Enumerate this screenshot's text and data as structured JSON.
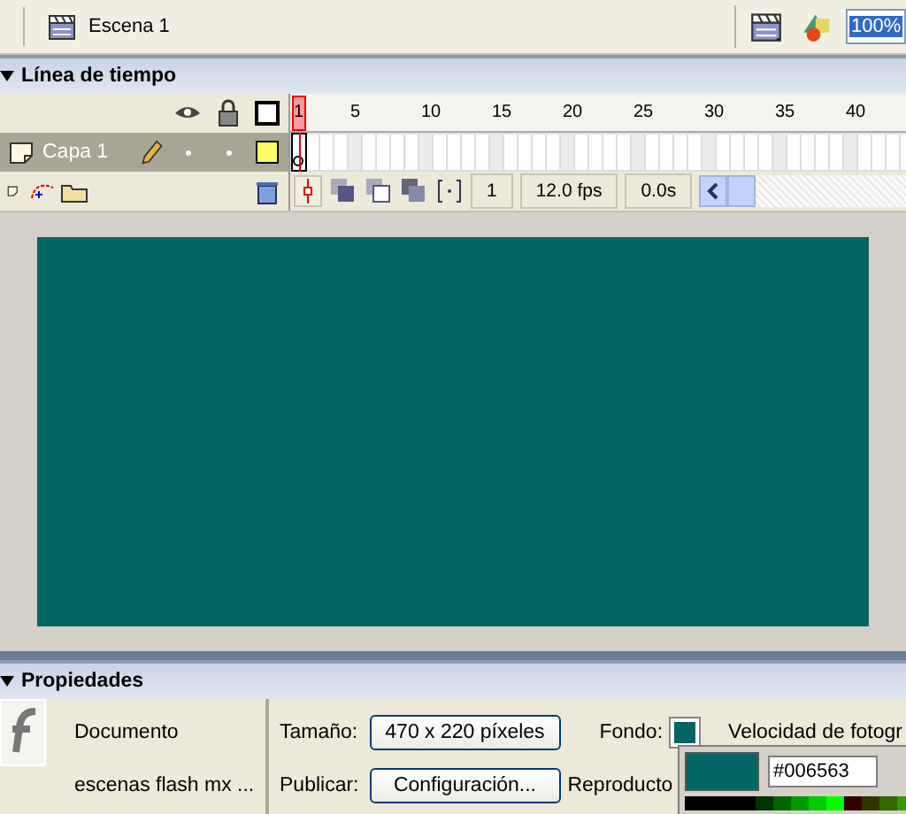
{
  "toolbar": {
    "scene": "Escena 1",
    "zoom": "100%"
  },
  "timeline": {
    "title": "Línea de tiempo",
    "frame_numbers": [
      "1",
      "5",
      "10",
      "15",
      "20",
      "25",
      "30",
      "35",
      "40"
    ],
    "layers": [
      {
        "name": "Capa 1",
        "selected": true
      }
    ],
    "current_frame": "1",
    "frame_rate": "12.0 fps",
    "elapsed": "0.0s"
  },
  "properties": {
    "title": "Propiedades",
    "doc_label": "Documento",
    "doc_name": "escenas flash mx ...",
    "size_label": "Tamaño:",
    "size_button": "470 x 220 píxeles",
    "publish_label": "Publicar:",
    "publish_button": "Configuración...",
    "background_label": "Fondo:",
    "frame_rate_label": "Velocidad de fotogr",
    "player_label": "Reproducto"
  },
  "color_picker": {
    "value": "#006563"
  }
}
